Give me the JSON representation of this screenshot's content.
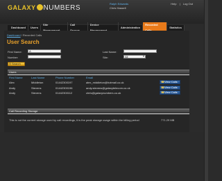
{
  "header": {
    "logo_left": "GALAXY",
    "logo_right": "NUMBERS",
    "user_line1": "Ralph Edwards",
    "user_line2": "Chris Hassell",
    "help": "Help",
    "logout": "Log Out"
  },
  "nav": [
    "Dashboard",
    "Users",
    "Site Management",
    "Call Groups",
    "Device Management",
    "Administration",
    "Recorded Calls",
    "Statistics"
  ],
  "breadcrumb": {
    "link": "Dashboard",
    "current": " / Recorded Calls"
  },
  "page_title": "User Search",
  "form": {
    "first_name_label": "First Name:",
    "first_name_value": "A",
    "number_label": "Number:",
    "number_value": "",
    "last_name_label": "Last Name:",
    "last_name_value": "",
    "site_label": "Site:",
    "site_value": "All",
    "search_label": "Search"
  },
  "users_section": {
    "title": "Users",
    "columns": [
      "First Name",
      "Last Name",
      "Phone Number",
      "Email"
    ],
    "rows": [
      {
        "first": "Alex",
        "last": "Middleton",
        "phone": "01442300197",
        "email": "alex_middleton@hotmail.co.uk",
        "action": "View Calls"
      },
      {
        "first": "Andy",
        "last": "Stevens",
        "phone": "01442300196",
        "email": "andy.stevens@galaxytelecom.co.uk",
        "action": "View Calls"
      },
      {
        "first": "Andy",
        "last": "Stevens",
        "phone": "01442300112",
        "email": "chris@galaxynumbers.co.uk",
        "action": "View Calls"
      }
    ]
  },
  "storage_section": {
    "title": "Call Recording Storage",
    "description": "This is not the current storage used by call recordings, it is the peak storage usage within the billing period",
    "value": "771.29 MB"
  }
}
